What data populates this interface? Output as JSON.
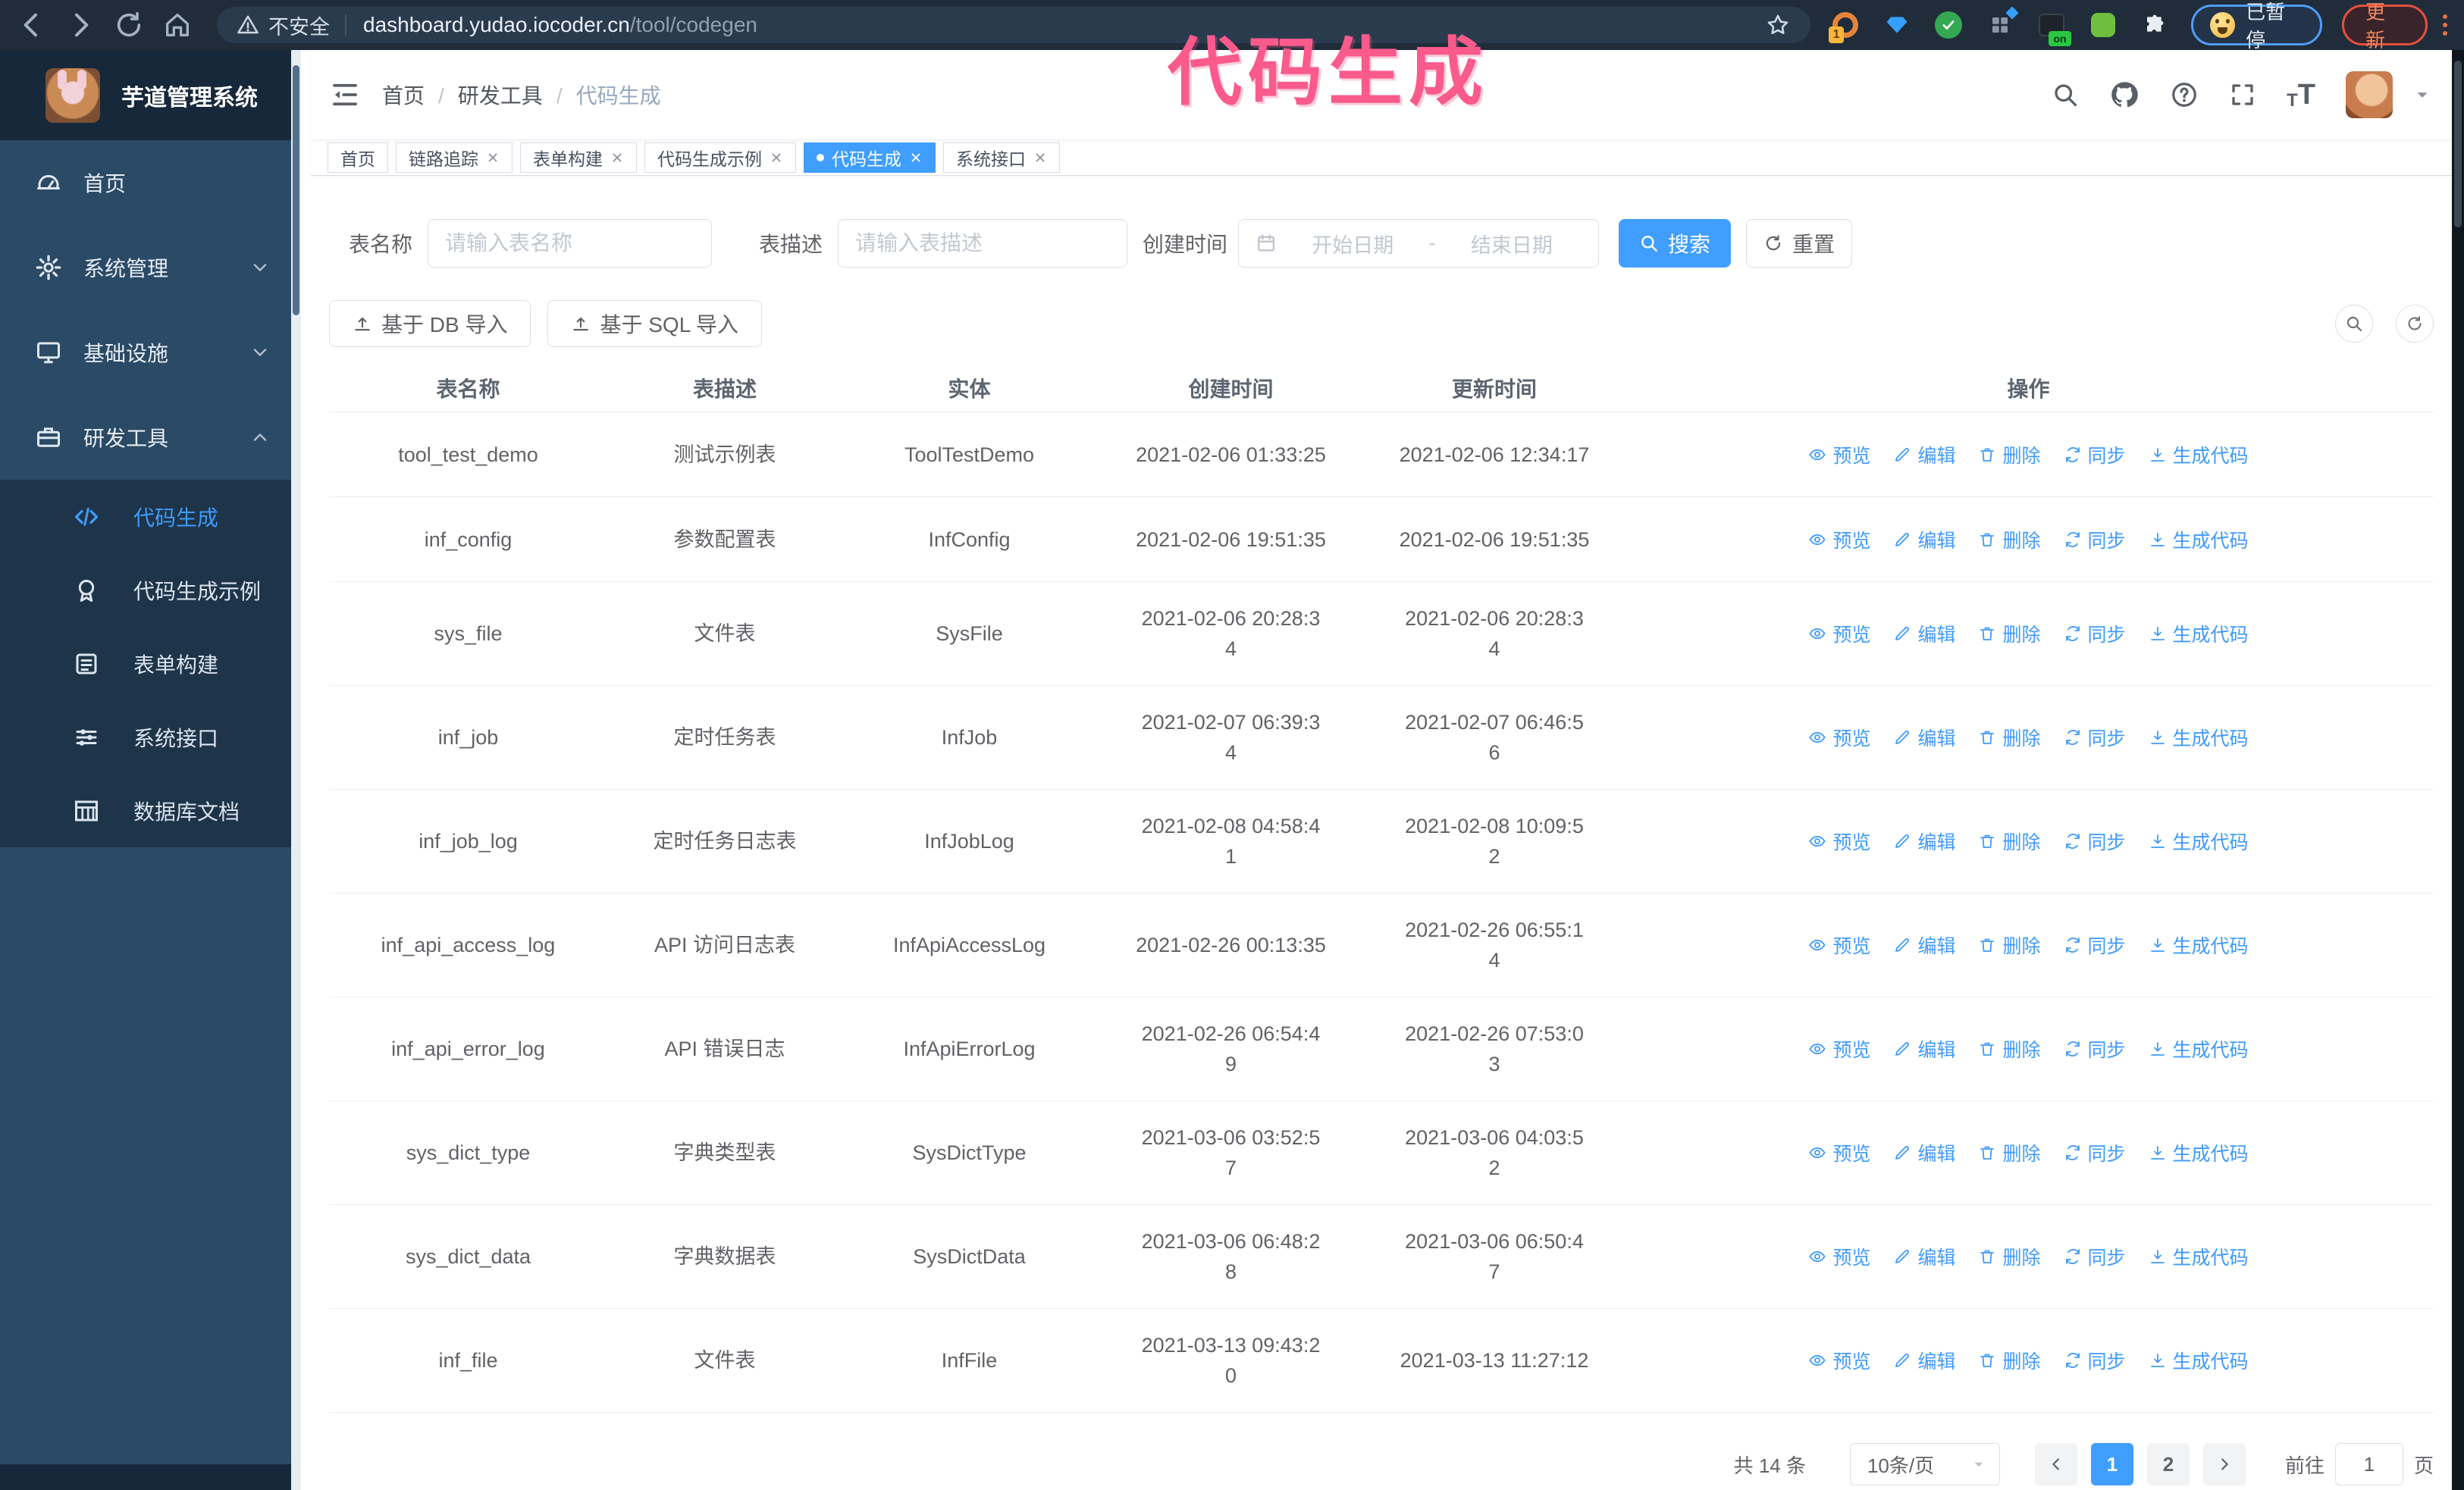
{
  "colors": {
    "accent": "#409eff",
    "annotation_pink": "#fa5a8c",
    "sidebar_bg": "#2b4a66",
    "submenu_bg": "#1e3449"
  },
  "browser": {
    "security_label": "不安全",
    "url_domain": "dashboard.yudao.iocoder.cn",
    "url_path": "/tool/codegen",
    "extension_badge_count": "1",
    "extension_badge_on": "on",
    "paused_badge": "已暂停",
    "update_label": "更新"
  },
  "annotation": {
    "text": "代码生成"
  },
  "sidebar": {
    "logo_title": "芋道管理系统",
    "menu": [
      {
        "label": "首页",
        "icon": "dashboard-icon",
        "expand": ""
      },
      {
        "label": "系统管理",
        "icon": "gear-icon",
        "expand": "down"
      },
      {
        "label": "基础设施",
        "icon": "monitor-icon",
        "expand": "down"
      },
      {
        "label": "研发工具",
        "icon": "toolbox-icon",
        "expand": "up"
      }
    ],
    "submenu": [
      {
        "label": "代码生成",
        "icon": "code-icon",
        "active": true
      },
      {
        "label": "代码生成示例",
        "icon": "badge-icon",
        "active": false
      },
      {
        "label": "表单构建",
        "icon": "form-icon",
        "active": false
      },
      {
        "label": "系统接口",
        "icon": "sliders-icon",
        "active": false
      },
      {
        "label": "数据库文档",
        "icon": "db-table-icon",
        "active": false
      }
    ]
  },
  "header": {
    "breadcrumb": [
      {
        "label": "首页",
        "current": false
      },
      {
        "label": "研发工具",
        "current": false
      },
      {
        "label": "代码生成",
        "current": true
      }
    ]
  },
  "tabs": [
    {
      "label": "首页",
      "closable": false,
      "active": false
    },
    {
      "label": "链路追踪",
      "closable": true,
      "active": false
    },
    {
      "label": "表单构建",
      "closable": true,
      "active": false
    },
    {
      "label": "代码生成示例",
      "closable": true,
      "active": false
    },
    {
      "label": "代码生成",
      "closable": true,
      "active": true
    },
    {
      "label": "系统接口",
      "closable": true,
      "active": false
    }
  ],
  "filters": {
    "name_label": "表名称",
    "name_placeholder": "请输入表名称",
    "desc_label": "表描述",
    "desc_placeholder": "请输入表描述",
    "time_label": "创建时间",
    "start_placeholder": "开始日期",
    "range_separator": "-",
    "end_placeholder": "结束日期",
    "search_label": "搜索",
    "reset_label": "重置"
  },
  "toolbar": {
    "import_db_label": "基于 DB 导入",
    "import_sql_label": "基于 SQL 导入"
  },
  "table": {
    "columns": [
      "表名称",
      "表描述",
      "实体",
      "创建时间",
      "更新时间",
      "操作"
    ],
    "actions": [
      {
        "label": "预览",
        "icon": "eye-icon"
      },
      {
        "label": "编辑",
        "icon": "edit-icon"
      },
      {
        "label": "删除",
        "icon": "delete-icon"
      },
      {
        "label": "同步",
        "icon": "sync-icon"
      },
      {
        "label": "生成代码",
        "icon": "download-icon"
      }
    ],
    "rows": [
      {
        "name": "tool_test_demo",
        "desc": "测试示例表",
        "entity": "ToolTestDemo",
        "created": "2021-02-06 01:33:25",
        "updated": "2021-02-06 12:34:17"
      },
      {
        "name": "inf_config",
        "desc": "参数配置表",
        "entity": "InfConfig",
        "created": "2021-02-06 19:51:35",
        "updated": "2021-02-06 19:51:35"
      },
      {
        "name": "sys_file",
        "desc": "文件表",
        "entity": "SysFile",
        "created": "2021-02-06 20:28:3\n4",
        "updated": "2021-02-06 20:28:3\n4"
      },
      {
        "name": "inf_job",
        "desc": "定时任务表",
        "entity": "InfJob",
        "created": "2021-02-07 06:39:3\n4",
        "updated": "2021-02-07 06:46:5\n6"
      },
      {
        "name": "inf_job_log",
        "desc": "定时任务日志表",
        "entity": "InfJobLog",
        "created": "2021-02-08 04:58:4\n1",
        "updated": "2021-02-08 10:09:5\n2"
      },
      {
        "name": "inf_api_access_log",
        "desc": "API 访问日志表",
        "entity": "InfApiAccessLog",
        "created": "2021-02-26 00:13:35",
        "updated": "2021-02-26 06:55:1\n4"
      },
      {
        "name": "inf_api_error_log",
        "desc": "API 错误日志",
        "entity": "InfApiErrorLog",
        "created": "2021-02-26 06:54:4\n9",
        "updated": "2021-02-26 07:53:0\n3"
      },
      {
        "name": "sys_dict_type",
        "desc": "字典类型表",
        "entity": "SysDictType",
        "created": "2021-03-06 03:52:5\n7",
        "updated": "2021-03-06 04:03:5\n2"
      },
      {
        "name": "sys_dict_data",
        "desc": "字典数据表",
        "entity": "SysDictData",
        "created": "2021-03-06 06:48:2\n8",
        "updated": "2021-03-06 06:50:4\n7"
      },
      {
        "name": "inf_file",
        "desc": "文件表",
        "entity": "InfFile",
        "created": "2021-03-13 09:43:2\n0",
        "updated": "2021-03-13 11:27:12"
      }
    ]
  },
  "pagination": {
    "total_label": "共 14 条",
    "page_size_label": "10条/页",
    "pages": [
      {
        "label": "1",
        "active": true
      },
      {
        "label": "2",
        "active": false
      }
    ],
    "goto_label": "前往",
    "goto_value": "1",
    "goto_suffix": "页"
  }
}
